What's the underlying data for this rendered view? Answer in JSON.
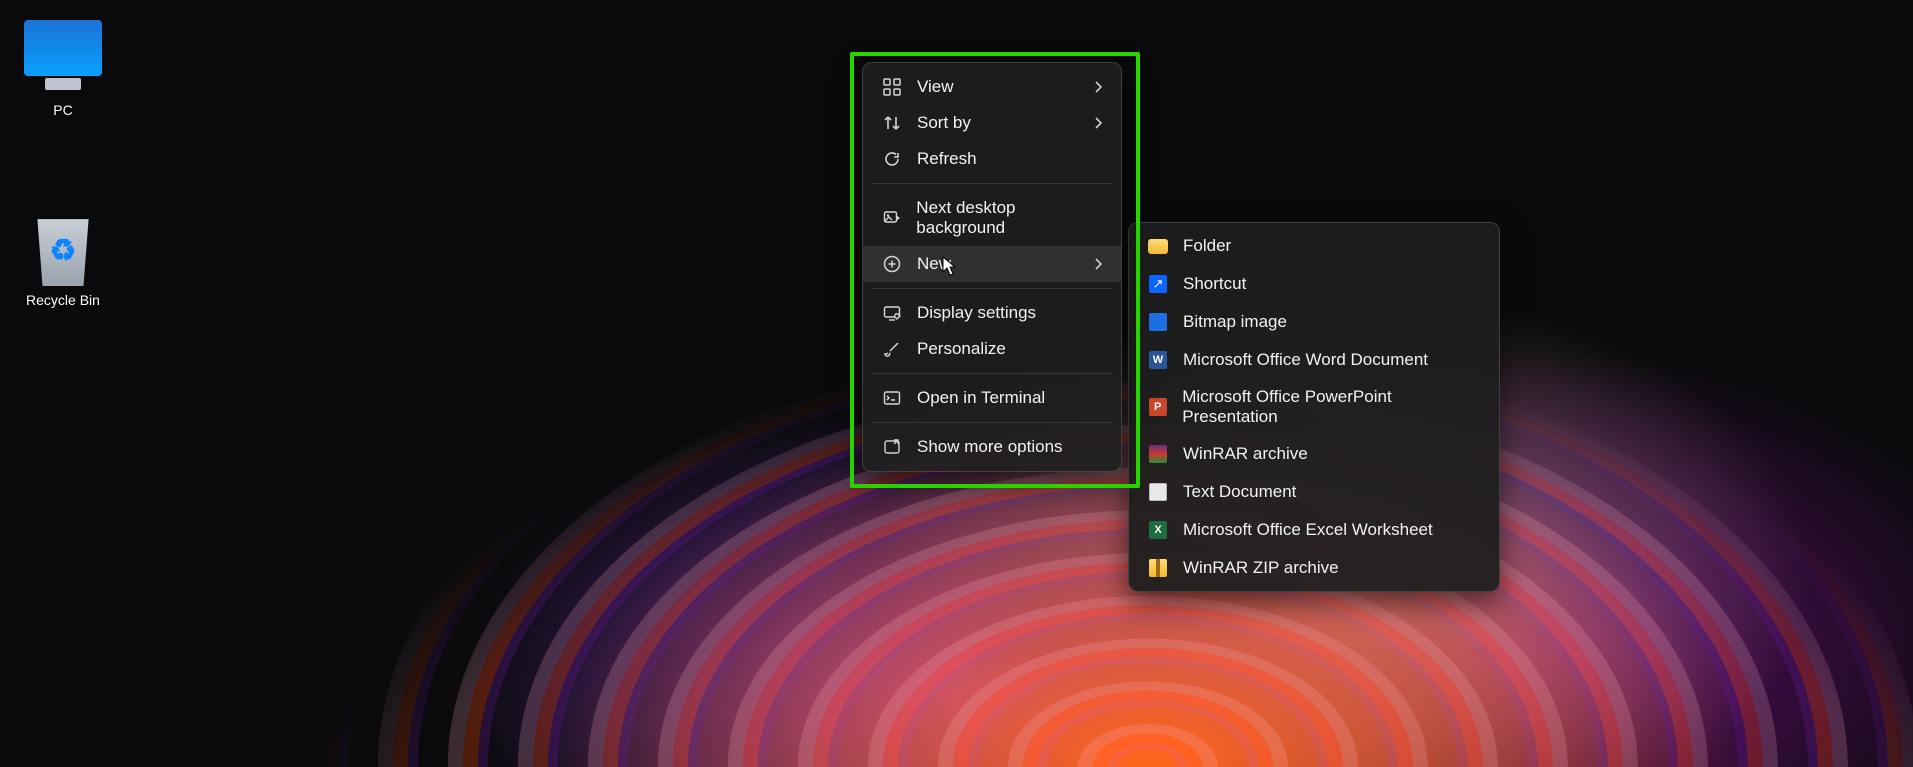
{
  "desktop": {
    "icons": {
      "pc": "PC",
      "recycle_bin": "Recycle Bin"
    }
  },
  "context_menu": {
    "view": "View",
    "sort_by": "Sort by",
    "refresh": "Refresh",
    "next_bg": "Next desktop background",
    "new": "New",
    "display_settings": "Display settings",
    "personalize": "Personalize",
    "open_terminal": "Open in Terminal",
    "show_more": "Show more options"
  },
  "new_submenu": {
    "folder": "Folder",
    "shortcut": "Shortcut",
    "bitmap": "Bitmap image",
    "word": "Microsoft Office Word Document",
    "powerpoint": "Microsoft Office PowerPoint Presentation",
    "winrar": "WinRAR archive",
    "text": "Text Document",
    "excel": "Microsoft Office Excel Worksheet",
    "winrar_zip": "WinRAR ZIP archive"
  }
}
